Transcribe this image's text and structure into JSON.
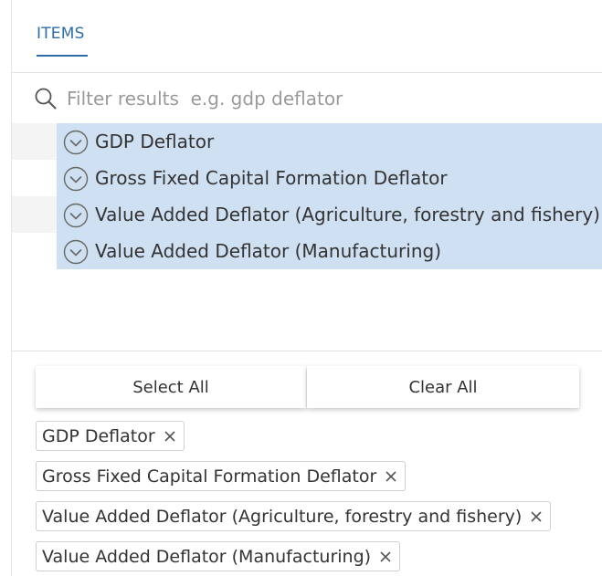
{
  "tabs": {
    "items_label": "ITEMS"
  },
  "search": {
    "placeholder": "Filter results  e.g. gdp deflator",
    "value": ""
  },
  "results": [
    {
      "label": "GDP Deflator",
      "selected": true
    },
    {
      "label": "Gross Fixed Capital Formation Deflator",
      "selected": true
    },
    {
      "label": "Value Added Deflator (Agriculture, forestry and fishery)",
      "selected": true
    },
    {
      "label": "Value Added Deflator (Manufacturing)",
      "selected": true
    }
  ],
  "actions": {
    "select_all": "Select All",
    "clear_all": "Clear All"
  },
  "chips": [
    {
      "label": "GDP Deflator"
    },
    {
      "label": "Gross Fixed Capital Formation Deflator"
    },
    {
      "label": "Value Added Deflator (Agriculture, forestry and fishery)"
    },
    {
      "label": "Value Added Deflator (Manufacturing)"
    }
  ],
  "colors": {
    "accent": "#2e6ea8",
    "selection": "#cfe0f3",
    "stripe": "#f4f4f4"
  }
}
